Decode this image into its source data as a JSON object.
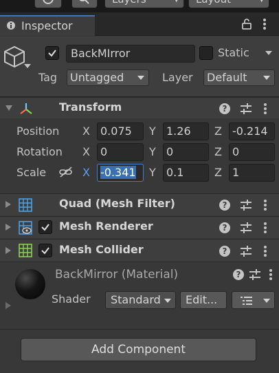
{
  "toolbar": {
    "layers_label": "Layers",
    "layout_label": "Layout"
  },
  "inspector_tab": {
    "label": "Inspector"
  },
  "object": {
    "name": "BackMIrror",
    "static_label": "Static",
    "tag_label": "Tag",
    "tag_value": "Untagged",
    "layer_label": "Layer",
    "layer_value": "Default",
    "active": true,
    "static": false
  },
  "transform": {
    "title": "Transform",
    "rows": [
      {
        "label": "Position",
        "x": "0.075",
        "y": "1.26",
        "z": "-0.214"
      },
      {
        "label": "Rotation",
        "x": "0",
        "y": "0",
        "z": "0"
      },
      {
        "label": "Scale",
        "x_sel": "-",
        "x_rest": "0.341",
        "y": "0.1",
        "z": "1"
      }
    ],
    "axis_x": "X",
    "axis_y": "Y",
    "axis_z": "Z"
  },
  "components": [
    {
      "title": "Quad (Mesh Filter)",
      "has_toggle": false
    },
    {
      "title": "Mesh Renderer",
      "has_toggle": true
    },
    {
      "title": "Mesh Collider",
      "has_toggle": true
    }
  ],
  "material": {
    "title": "BackMirror (Material)",
    "shader_label": "Shader",
    "shader_value": "Standard",
    "edit_label": "Edit..."
  },
  "add_component": "Add Component",
  "colors": {
    "accent": "#3a79bb",
    "selection": "#3a6fb0",
    "panel": "#383838"
  }
}
